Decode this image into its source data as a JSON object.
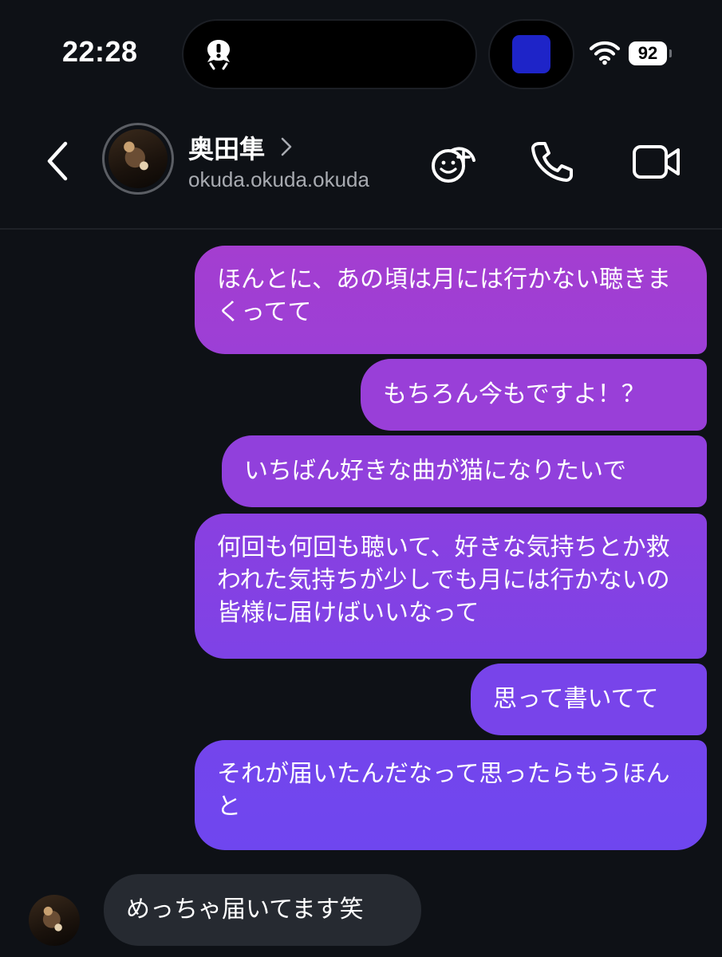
{
  "status_bar": {
    "time": "22:28",
    "battery": "92",
    "island_icon": "alert-face-icon",
    "app_tile_color": "#1e24c8"
  },
  "header": {
    "name": "奥田隼",
    "handle": "okuda.okuda.okuda",
    "icons": [
      "back-icon",
      "sticker-add-icon",
      "phone-icon",
      "video-icon"
    ]
  },
  "messages": [
    {
      "direction": "outgoing",
      "text": "ほんとに、あの頃は月には行かない聴きまくってて"
    },
    {
      "direction": "outgoing",
      "text": "もちろん今もですよ！？"
    },
    {
      "direction": "outgoing",
      "text": "いちばん好きな曲が猫になりたいで"
    },
    {
      "direction": "outgoing",
      "text": "何回も何回も聴いて、好きな気持ちとか救われた気持ちが少しでも月には行かないの皆様に届けばいいなって"
    },
    {
      "direction": "outgoing",
      "text": "思って書いてて"
    },
    {
      "direction": "outgoing",
      "text": "それが届いたんだなって思ったらもうほんと"
    },
    {
      "direction": "incoming",
      "text": "めっちゃ届いてます笑"
    }
  ],
  "colors": {
    "background": "#0e1116",
    "outgoing_top": "#a43ed0",
    "outgoing_bottom": "#6f46ef",
    "incoming": "#262a31"
  }
}
